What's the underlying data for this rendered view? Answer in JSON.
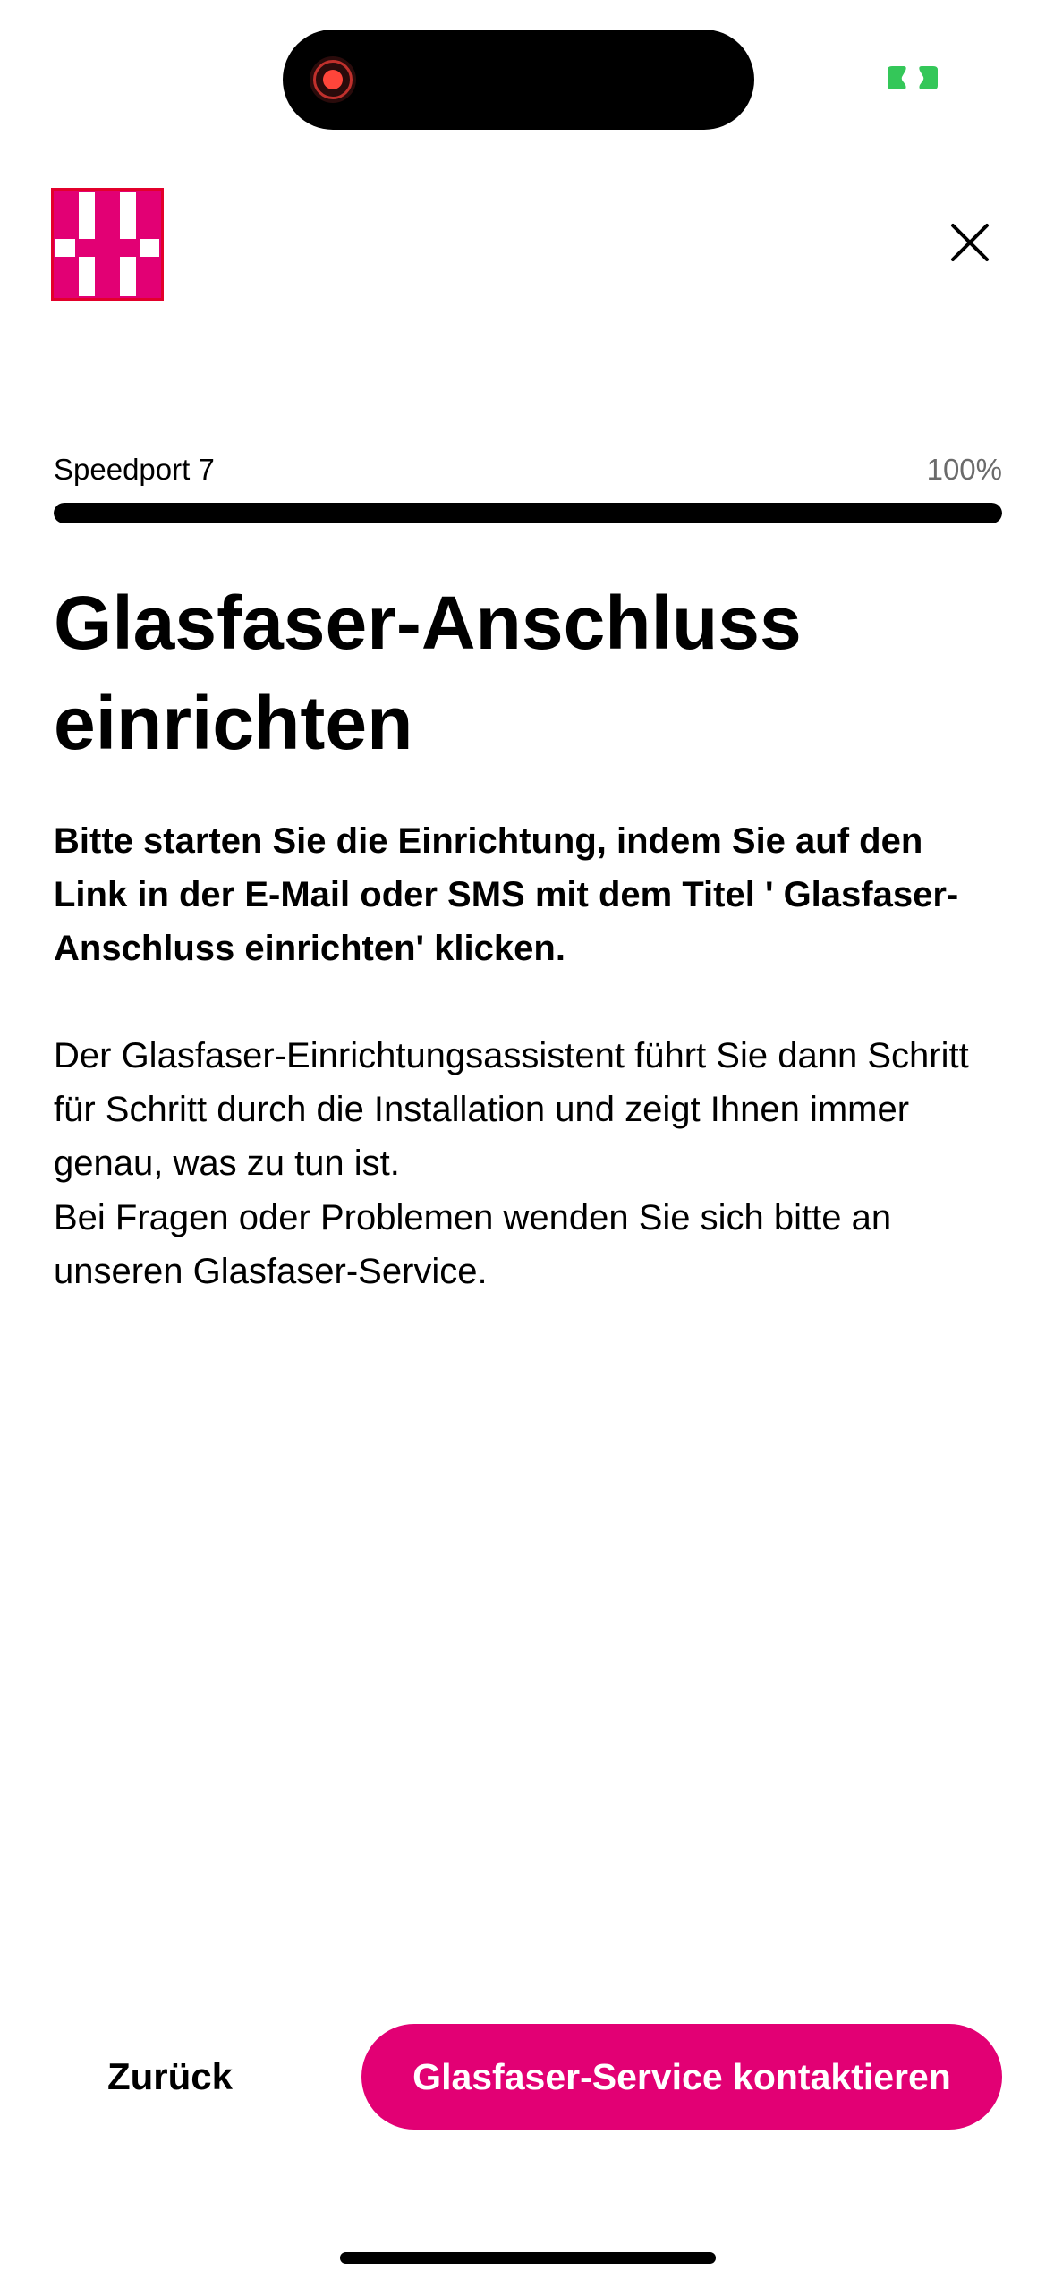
{
  "app": {
    "brand_color": "#e20074",
    "logo_icon": "telekom-t-logo",
    "close_icon": "close-icon"
  },
  "progress": {
    "label": "Speedport 7",
    "percent_text": "100%",
    "value": 1.0
  },
  "content": {
    "title": "Glasfaser-Anschluss einrichten",
    "intro_bold": "Bitte starten Sie die Einrichtung, indem Sie auf den Link in der E-Mail oder SMS mit dem Titel ' Glasfaser-Anschluss einrichten' klicken.",
    "body_line1": "Der Glasfaser-Einrichtungsassistent führt Sie dann Schritt für Schritt durch die Installation und zeigt Ihnen immer genau, was zu tun ist.",
    "body_line2": "Bei Fragen oder Problemen wenden Sie sich bitte an unseren Glasfaser-Service."
  },
  "footer": {
    "back_label": "Zurück",
    "contact_label": "Glasfaser-Service kontaktieren"
  }
}
